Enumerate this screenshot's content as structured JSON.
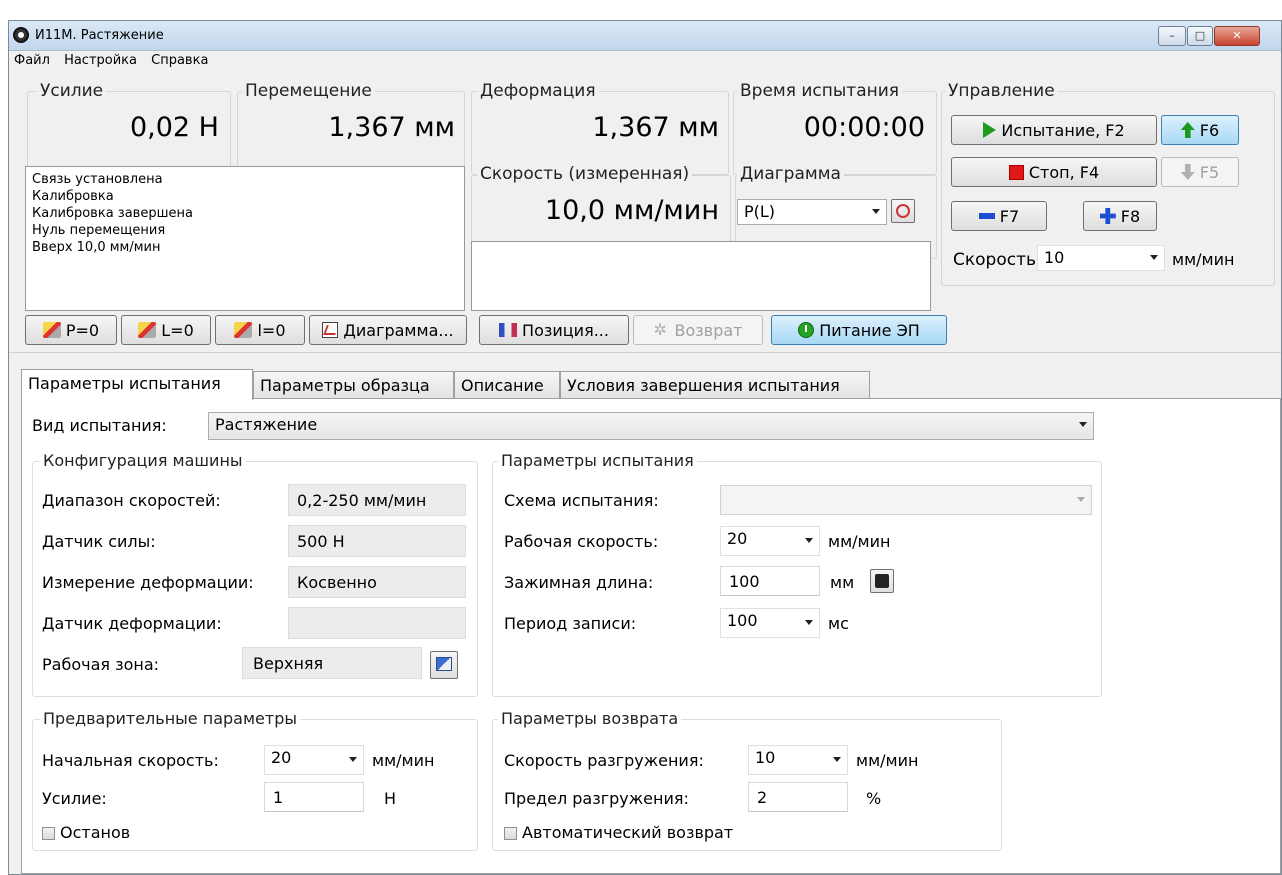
{
  "window": {
    "title": "И11М. Растяжение",
    "controls": {
      "minimize": "–",
      "maximize": "□",
      "close": "✕"
    }
  },
  "menu": {
    "items": [
      "Файл",
      "Настройка",
      "Справка"
    ]
  },
  "readouts": {
    "force": {
      "label": "Усилие",
      "value": "0,02 Н"
    },
    "displacement": {
      "label": "Перемещение",
      "value": "1,367 мм"
    },
    "deformation": {
      "label": "Деформация",
      "value": "1,367 мм"
    },
    "test_time": {
      "label": "Время испытания",
      "value": "00:00:00"
    },
    "speed_measured": {
      "label": "Скорость (измеренная)",
      "value": "10,0 мм/мин"
    }
  },
  "diagram": {
    "label": "Диаграмма",
    "selected": "P(L)"
  },
  "log": {
    "lines": [
      "Связь установлена",
      "Калибровка",
      "Калибровка завершена",
      "Нуль перемещения",
      "Вверх 10,0 мм/мин"
    ]
  },
  "control": {
    "label": "Управление",
    "test_button": "Испытание, F2",
    "f6_button": "F6",
    "stop_button": "Стоп, F4",
    "f5_button": "F5",
    "f7_button": "F7",
    "f8_button": "F8",
    "speed_label": "Скорость:",
    "speed_value": "10",
    "speed_unit": "мм/мин"
  },
  "toolbar": {
    "p_zero": "P=0",
    "l_zero": "L=0",
    "i_zero": "l=0",
    "diagram": "Диаграмма...",
    "position": "Позиция...",
    "return": "Возврат",
    "power": "Питание ЭП"
  },
  "tabs": [
    "Параметры испытания",
    "Параметры образца",
    "Описание",
    "Условия завершения испытания"
  ],
  "test_params": {
    "test_type_label": "Вид испытания:",
    "test_type_value": "Растяжение",
    "machine_config": {
      "label": "Конфигурация машины",
      "speed_range_label": "Диапазон скоростей:",
      "speed_range_value": "0,2-250 мм/мин",
      "force_sensor_label": "Датчик силы:",
      "force_sensor_value": "500 Н",
      "deform_measure_label": "Измерение деформации:",
      "deform_measure_value": "Косвенно",
      "deform_sensor_label": "Датчик  деформации:",
      "deform_sensor_value": "",
      "work_zone_label": "Рабочая зона:",
      "work_zone_value": "Верхняя"
    },
    "params": {
      "label": "Параметры испытания",
      "scheme_label": "Схема испытания:",
      "scheme_value": "",
      "work_speed_label": "Рабочая скорость:",
      "work_speed_value": "20",
      "work_speed_unit": "мм/мин",
      "clamp_length_label": "Зажимная длина:",
      "clamp_length_value": "100",
      "clamp_length_unit": "мм",
      "record_period_label": "Период записи:",
      "record_period_value": "100",
      "record_period_unit": "мс"
    },
    "preliminary": {
      "label": "Предварительные параметры",
      "initial_speed_label": "Начальная скорость:",
      "initial_speed_value": "20",
      "initial_speed_unit": "мм/мин",
      "force_label": "Усилие:",
      "force_value": "1",
      "force_unit": "Н",
      "stop_label": "Останов"
    },
    "return_params": {
      "label": "Параметры возврата",
      "unload_speed_label": "Скорость разгружения:",
      "unload_speed_value": "10",
      "unload_speed_unit": "мм/мин",
      "unload_limit_label": "Предел разгружения:",
      "unload_limit_value": "2",
      "unload_limit_unit": "%",
      "auto_return_label": "Автоматический возврат"
    }
  }
}
